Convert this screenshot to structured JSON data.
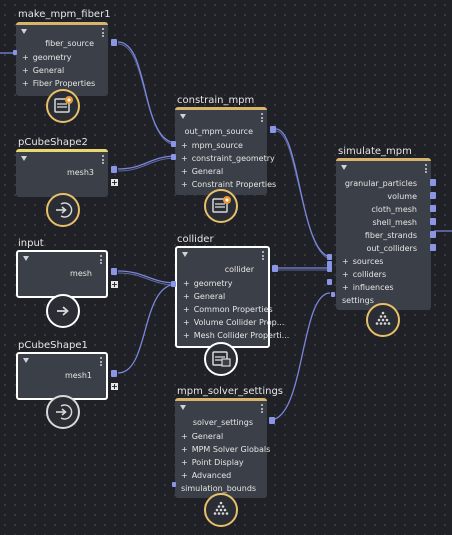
{
  "nodes": {
    "make_mpm_fiber1": {
      "title": "make_mpm_fiber1",
      "output": "fiber_source",
      "inputs": [
        "geometry",
        "General",
        "Fiber Properties"
      ]
    },
    "constrain_mpm": {
      "title": "constrain_mpm",
      "output": "out_mpm_source",
      "inputs": [
        "mpm_source",
        "constraint_geometry",
        "General",
        "Constraint Properties"
      ]
    },
    "pCubeShape2": {
      "title": "pCubeShape2",
      "output": "mesh3"
    },
    "input": {
      "title": "input",
      "output": "mesh"
    },
    "pCubeShape1": {
      "title": "pCubeShape1",
      "output": "mesh1"
    },
    "collider": {
      "title": "collider",
      "output": "collider",
      "inputs": [
        "geometry",
        "General",
        "Common Properties",
        "Volume Collider Prop...",
        "Mesh Collider Properti..."
      ]
    },
    "mpm_solver_settings": {
      "title": "mpm_solver_settings",
      "output": "solver_settings",
      "inputs": [
        "General",
        "MPM Solver Globals",
        "Point Display",
        "Advanced"
      ],
      "extra_input": "simulation_bounds"
    },
    "simulate_mpm": {
      "title": "simulate_mpm",
      "outputs": [
        "granular_particles",
        "volume",
        "cloth_mesh",
        "shell_mesh",
        "fiber_strands",
        "out_colliders"
      ],
      "inputs": [
        "sources",
        "colliders",
        "influences"
      ],
      "extra_input": "settings"
    }
  },
  "icons": {
    "compound": "compound-icon",
    "input": "arrow-in-icon",
    "simulate": "particles-icon"
  },
  "colors": {
    "background": "#1f2126",
    "node": "#3b3f47",
    "accent_gold": "#e8c06a",
    "port": "#8a95e6",
    "wire": "#7a86d8",
    "selected": "#ffffff",
    "fiber_wire": "#b8a0b8"
  }
}
